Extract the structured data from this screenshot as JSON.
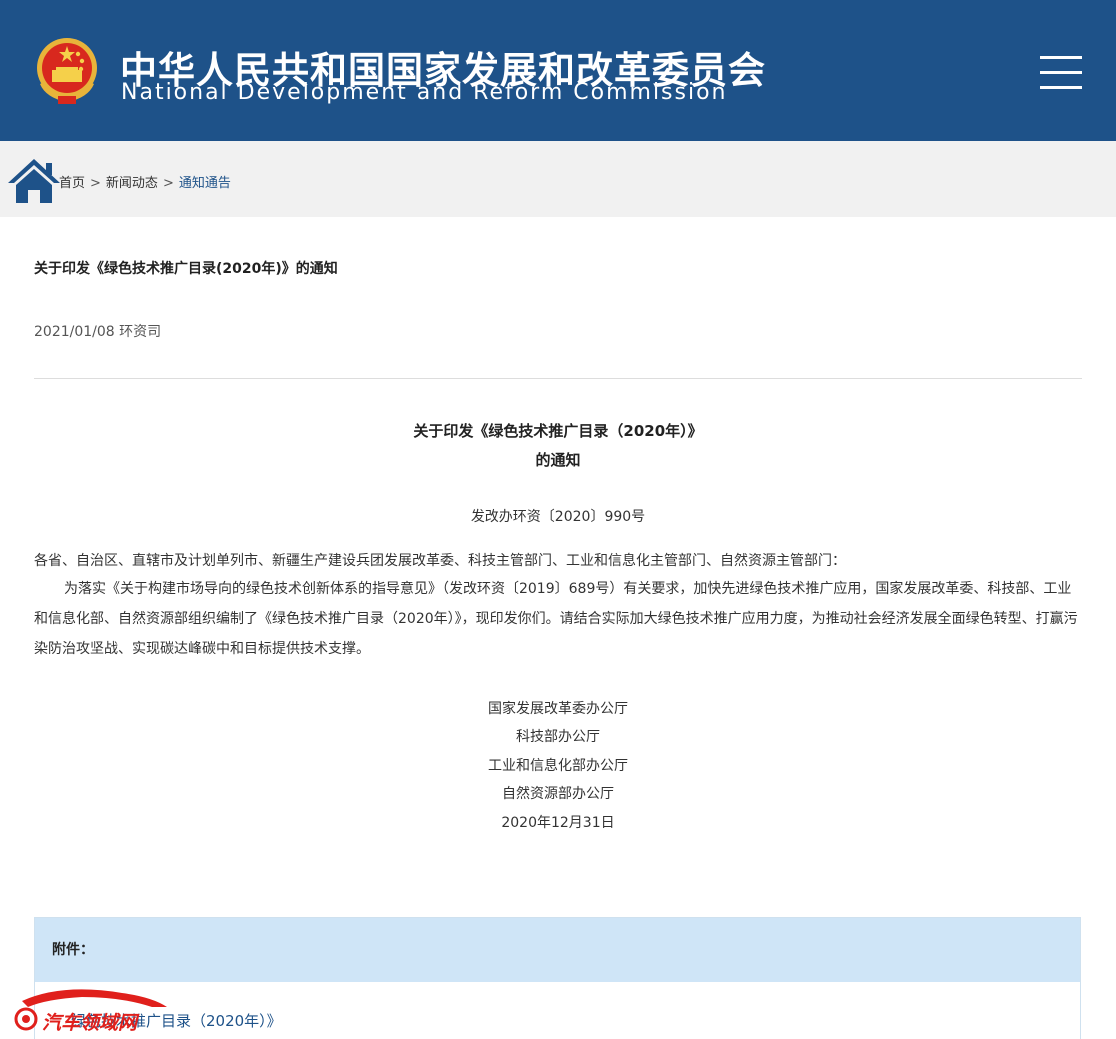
{
  "header": {
    "title_cn": "中华人民共和国国家发展和改革委员会",
    "title_en": "National Development and Reform Commission"
  },
  "breadcrumb": {
    "home": "首页",
    "sep": ">",
    "news": "新闻动态",
    "current": "通知通告"
  },
  "article": {
    "title": "关于印发《绿色技术推广目录(2020年)》的通知",
    "meta": "2021/01/08 环资司"
  },
  "document": {
    "heading_line1": "关于印发《绿色技术推广目录（2020年）》",
    "heading_line2": "的通知",
    "doc_number": "发改办环资〔2020〕990号",
    "recipients": "各省、自治区、直辖市及计划单列市、新疆生产建设兵团发展改革委、科技主管部门、工业和信息化主管部门、自然资源主管部门：",
    "body": "为落实《关于构建市场导向的绿色技术创新体系的指导意见》（发改环资〔2019〕689号）有关要求，加快先进绿色技术推广应用，国家发展改革委、科技部、工业和信息化部、自然资源部组织编制了《绿色技术推广目录（2020年）》，现印发你们。请结合实际加大绿色技术推广应用力度，为推动社会经济发展全面绿色转型、打赢污染防治攻坚战、实现碳达峰碳中和目标提供技术支撑。",
    "signatories": [
      "国家发展改革委办公厅",
      "科技部办公厅",
      "工业和信息化部办公厅",
      "自然资源部办公厅"
    ],
    "date": "2020年12月31日"
  },
  "attachment": {
    "label": "附件：",
    "link_text": "绿色技术推广目录（2020年）》"
  },
  "watermark": {
    "text": "汽车领域网"
  },
  "colors": {
    "header_bg": "#1e5289",
    "crumb_bg": "#f1f1f1",
    "attach_head_bg": "#cfe5f7",
    "link": "#1e5289"
  }
}
